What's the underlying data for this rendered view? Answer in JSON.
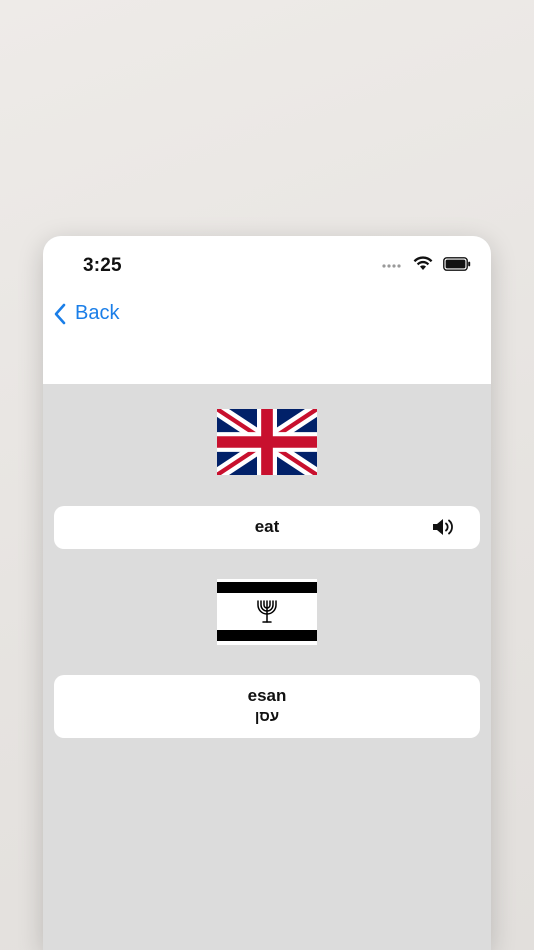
{
  "status_bar": {
    "time": "3:25"
  },
  "nav": {
    "back_label": "Back"
  },
  "source": {
    "flag": "united-kingdom-flag-icon",
    "word": "eat",
    "audio_icon": "speaker-icon"
  },
  "target": {
    "flag": "israel-menorah-flag-icon",
    "transliteration": "esan",
    "native": "עסן"
  },
  "colors": {
    "accent": "#1a7ee8",
    "background": "#dcdcdc",
    "card": "#ffffff"
  }
}
